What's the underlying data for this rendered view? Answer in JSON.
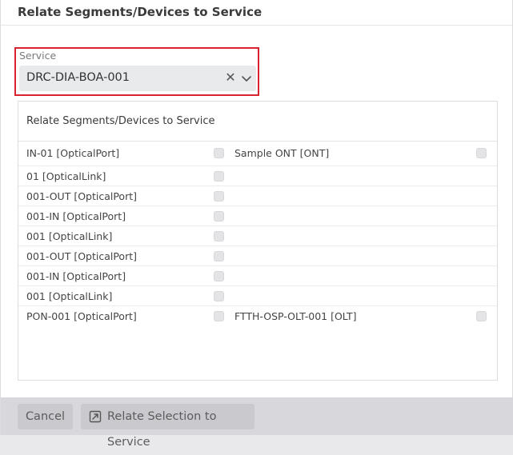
{
  "dialog": {
    "title": "Relate Segments/Devices to Service"
  },
  "service": {
    "label": "Service",
    "value": "DRC-DIA-BOA-001",
    "clear_icon": "close-icon",
    "dropdown_icon": "chevron-down-icon"
  },
  "panel": {
    "title": "Relate Segments/Devices to Service",
    "rows": [
      {
        "left": "IN-01 [OpticalPort]",
        "right": "Sample ONT [ONT]"
      },
      {
        "left": "01 [OpticalLink]",
        "right": ""
      },
      {
        "left": "001-OUT [OpticalPort]",
        "right": ""
      },
      {
        "left": "001-IN [OpticalPort]",
        "right": ""
      },
      {
        "left": "001 [OpticalLink]",
        "right": ""
      },
      {
        "left": "001-OUT [OpticalPort]",
        "right": ""
      },
      {
        "left": "001-IN [OpticalPort]",
        "right": ""
      },
      {
        "left": "001 [OpticalLink]",
        "right": ""
      },
      {
        "left": "PON-001 [OpticalPort]",
        "right": "FTTH-OSP-OLT-001 [OLT]"
      }
    ]
  },
  "footer": {
    "cancel_label": "Cancel",
    "relate_label": "Relate Selection to Service",
    "relate_icon": "link-icon"
  }
}
